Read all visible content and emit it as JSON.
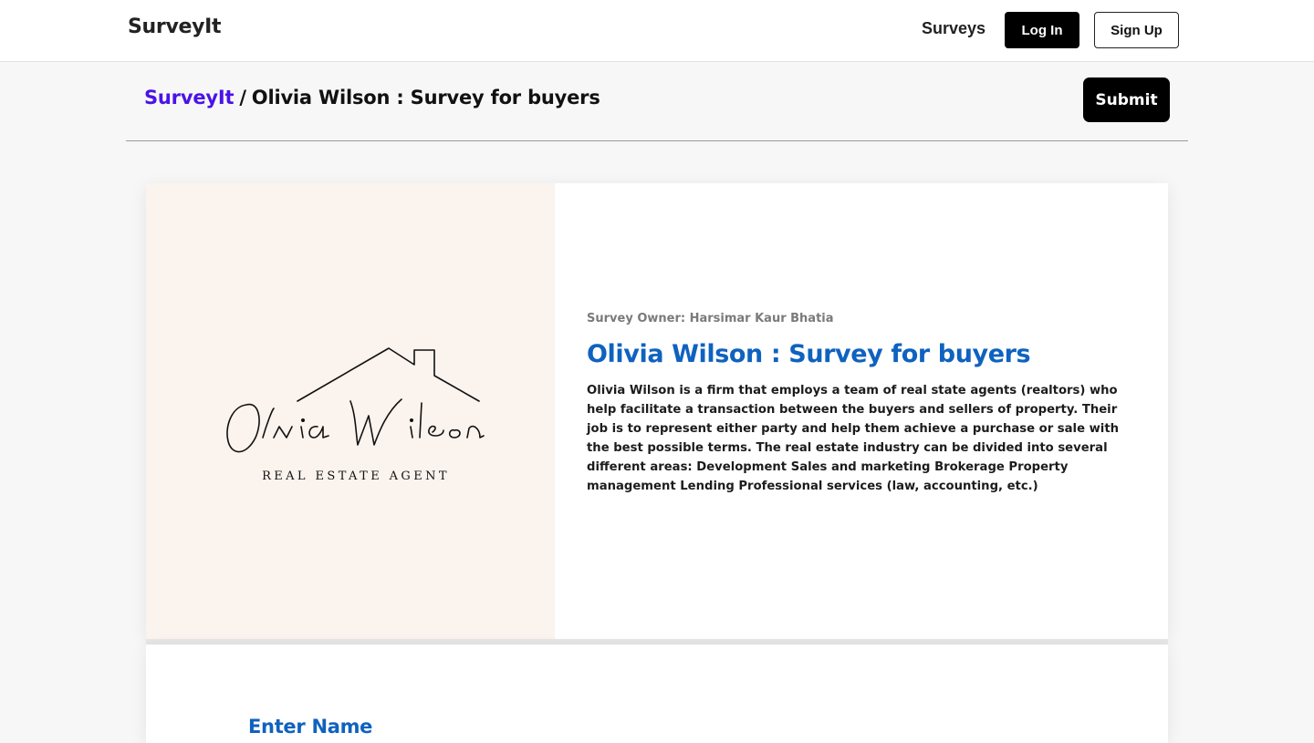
{
  "header": {
    "brand": "SurveyIt",
    "nav_surveys": "Surveys",
    "login_label": "Log In",
    "signup_label": "Sign Up"
  },
  "breadcrumb": {
    "root": "SurveyIt",
    "separator": "/",
    "current": "Olivia Wilson : Survey for buyers"
  },
  "actions": {
    "submit_label": "Submit"
  },
  "survey": {
    "logo": {
      "script_name": "Olivia Wilson",
      "tagline": "REAL ESTATE AGENT",
      "background": "#faf3ee"
    },
    "owner": "Survey Owner: Harsimar Kaur Bhatia",
    "title": "Olivia Wilson : Survey for buyers",
    "description": "Olivia Wilson is a firm that employs a team of real state agents (realtors) who help facilitate a transaction between the buyers and sellers of property. Their job is to represent either party and help them achieve a purchase or sale with the best possible terms. The real estate industry can be divided into several different areas: Development Sales and marketing Brokerage Property management Lending Professional services (law, accounting, etc.)"
  },
  "form": {
    "first_field_label": "Enter Name"
  },
  "colors": {
    "accent_blue": "#0f62bf",
    "brand_purple": "#4b12e8",
    "page_bg": "#f7f7f7"
  }
}
